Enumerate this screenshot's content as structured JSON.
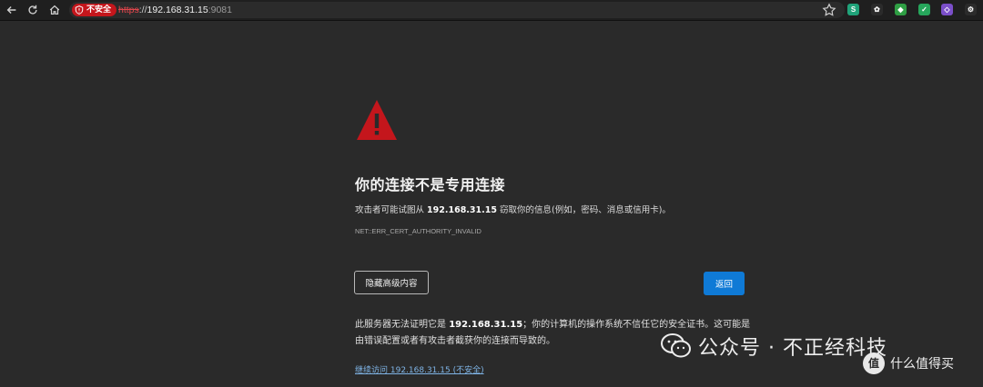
{
  "browser": {
    "security_label": "不安全",
    "url_scheme": "https",
    "url_sep": "://",
    "url_host": "192.168.31.15",
    "url_port": ":9081"
  },
  "extensions": [
    {
      "glyph": "S",
      "color": "#20a37a"
    },
    {
      "glyph": "✿",
      "color": "#2b2b2b"
    },
    {
      "glyph": "◆",
      "color": "#2f9e44"
    },
    {
      "glyph": "✓",
      "color": "#26a65b"
    },
    {
      "glyph": "◇",
      "color": "#7b4fc9"
    },
    {
      "glyph": "⚙",
      "color": "#2b2b2b"
    }
  ],
  "error": {
    "title": "你的连接不是专用连接",
    "desc_before": "攻击者可能试图从 ",
    "desc_host": "192.168.31.15",
    "desc_after": " 窃取你的信息(例如，密码、消息或信用卡)。",
    "code": "NET::ERR_CERT_AUTHORITY_INVALID",
    "advanced_button": "隐藏高级内容",
    "back_button": "返回",
    "details_before": "此服务器无法证明它是 ",
    "details_host": "192.168.31.15",
    "details_after": "；你的计算机的操作系统不信任它的安全证书。这可能是由错误配置或者有攻击者截获你的连接而导致的。",
    "proceed_link": "继续访问 192.168.31.15 (不安全)"
  },
  "watermark": {
    "text": "公众号 · 不正经科技",
    "corner_badge": "值",
    "corner_text": "什么值得买"
  },
  "colors": {
    "warning_red": "#c4161c",
    "primary_blue": "#0f7ad6",
    "link_blue": "#7fb4e6"
  }
}
